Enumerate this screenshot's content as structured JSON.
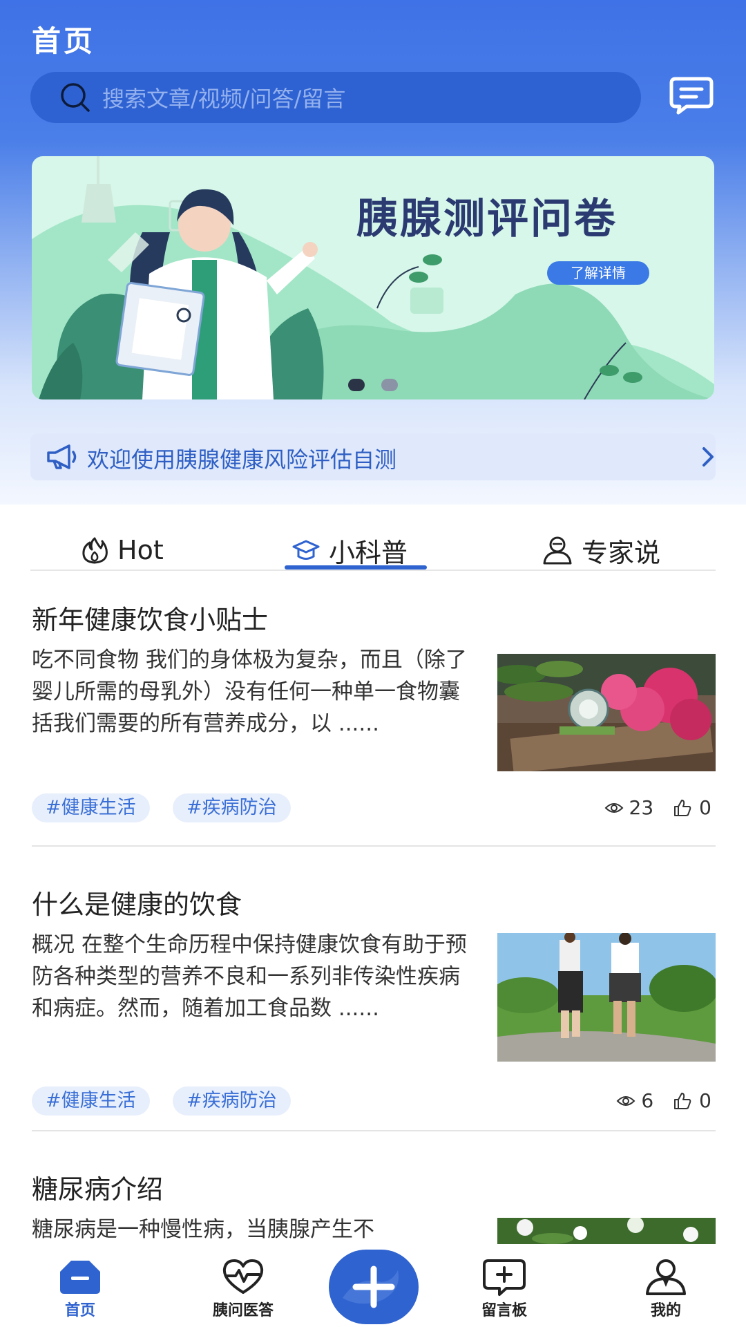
{
  "header": {
    "title": "首页",
    "search_placeholder": "搜索文章/视频/问答/留言"
  },
  "banner": {
    "title": "胰腺测评问卷",
    "button_label": "了解详情"
  },
  "notice": {
    "text": "欢迎使用胰腺健康风险评估自测"
  },
  "tabs": [
    {
      "label": "Hot",
      "active": false
    },
    {
      "label": "小科普",
      "active": true
    },
    {
      "label": "专家说",
      "active": false
    }
  ],
  "articles": [
    {
      "title": "新年健康饮食小贴士",
      "summary": "吃不同食物 我们的身体极为复杂，而且（除了婴儿所需的母乳外）没有任何一种单一食物囊括我们需要的所有营养成分，以 ......",
      "tags": [
        "#健康生活",
        "#疾病防治"
      ],
      "views": "23",
      "likes": "0"
    },
    {
      "title": "什么是健康的饮食",
      "summary": "概况 在整个生命历程中保持健康饮食有助于预防各种类型的营养不良和一系列非传染性疾病和病症。然而，随着加工食品数 ......",
      "tags": [
        "#健康生活",
        "#疾病防治"
      ],
      "views": "6",
      "likes": "0"
    },
    {
      "title": "糖尿病介绍",
      "summary": "糖尿病是一种慢性病，当胰腺产生不"
    }
  ],
  "nav": {
    "items": [
      {
        "label": "首页",
        "icon": "home-icon",
        "active": true
      },
      {
        "label": "胰问医答",
        "icon": "heart-pulse-icon",
        "active": false
      },
      {
        "label": "留言板",
        "icon": "message-add-icon",
        "active": false
      },
      {
        "label": "我的",
        "icon": "profile-icon",
        "active": false
      }
    ]
  },
  "colors": {
    "primary": "#2f63d0",
    "header_blue": "#3f72e6",
    "banner_bg": "#d6f7e9",
    "tag_bg": "#e8effc"
  }
}
